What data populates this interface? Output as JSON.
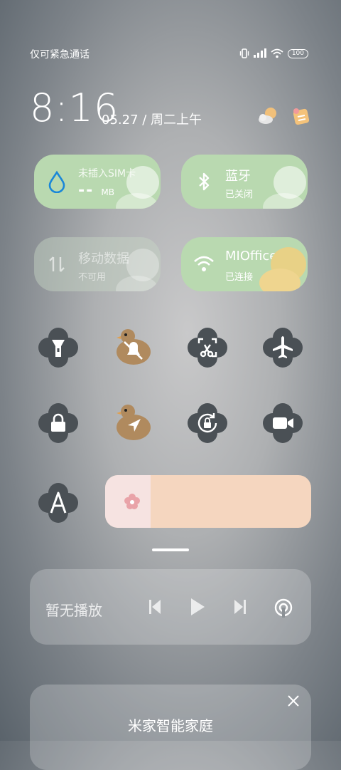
{
  "status_bar": {
    "carrier_text": "仅可紧急通话",
    "battery": "100",
    "icons": [
      "vibrate-icon",
      "signal-icon",
      "wifi-icon",
      "battery-icon"
    ]
  },
  "clock": {
    "time": "8:16",
    "date": "05.27 / 周二上午"
  },
  "header_icons": [
    "weather-icon",
    "edit-icon"
  ],
  "tiles": [
    {
      "title": "未插入SIM卡",
      "value": "--",
      "unit": "MB",
      "icon": "water-drop-icon",
      "enabled": true
    },
    {
      "title": "蓝牙",
      "sub": "已关闭",
      "icon": "bluetooth-icon",
      "enabled": true
    },
    {
      "title": "移动数据",
      "sub": "不可用",
      "icon": "data-arrows-icon",
      "enabled": false
    },
    {
      "title": "MIOffice-",
      "sub": "已连接",
      "icon": "wifi-icon",
      "enabled": true
    }
  ],
  "toggles": [
    {
      "name": "flashlight-icon"
    },
    {
      "name": "mute-bell-icon"
    },
    {
      "name": "screenshot-icon"
    },
    {
      "name": "airplane-icon"
    },
    {
      "name": "lock-icon"
    },
    {
      "name": "location-icon"
    },
    {
      "name": "rotation-lock-icon"
    },
    {
      "name": "video-camera-icon"
    },
    {
      "name": "font-icon"
    }
  ],
  "brightness": {
    "level": 0.22,
    "icon": "flower-icon"
  },
  "media": {
    "status": "暂无播放",
    "controls": [
      "previous-icon",
      "play-icon",
      "next-icon",
      "cast-icon"
    ]
  },
  "home_card": {
    "title": "米家智能家庭",
    "close_icon": "close-icon"
  },
  "colors": {
    "tile_on": "#b9d9b0",
    "slider_bg": "#f5d6bf",
    "slider_fill": "#f6e3e1",
    "clover": "#4a5055",
    "duck": "#b08a5e"
  }
}
